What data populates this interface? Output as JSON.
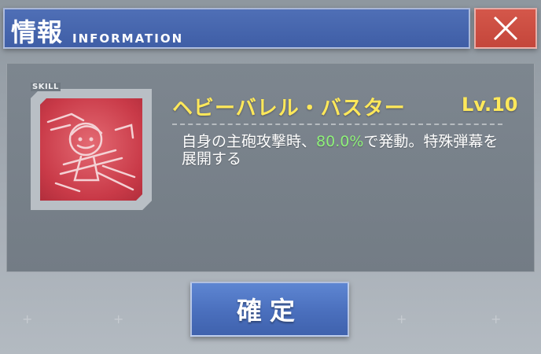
{
  "header": {
    "title": "情報",
    "subtitle": "INFORMATION"
  },
  "close_button": {
    "icon": "close-icon"
  },
  "skill": {
    "tag": "SKILL",
    "icon": "skill-portrait-icon",
    "name": "ヘビーバレル・バスター",
    "level": "Lv.10",
    "description": {
      "before": "自身の主砲攻撃時、",
      "highlight": "80.0%",
      "after": "で発動。特殊弾幕を展開する"
    }
  },
  "confirm_button": {
    "label": "確定"
  },
  "colors": {
    "header": "#4468ad",
    "close": "#cb4e43",
    "skill_name": "#ffe85a",
    "highlight": "#8ff07a",
    "confirm": "#4a6fbd",
    "icon_bg": "#c93a48"
  }
}
